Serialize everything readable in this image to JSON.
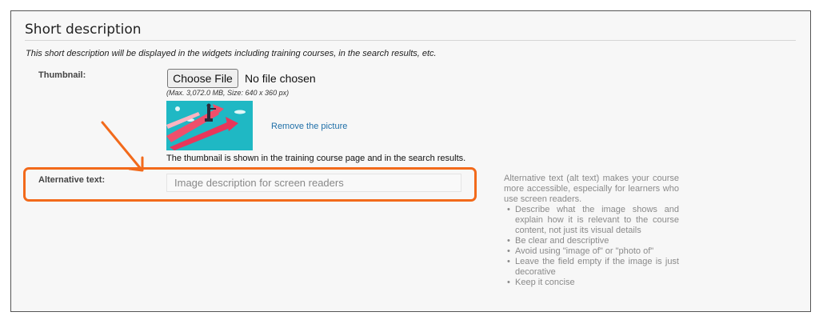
{
  "section": {
    "title": "Short description",
    "description": "This short description will be displayed in the widgets including training courses, in the search results, etc."
  },
  "thumbnail": {
    "label": "Thumbnail:",
    "choose_button": "Choose File",
    "no_file": "No file chosen",
    "hint": "(Max. 3,072.0 MB, Size: 640 x 360 px)",
    "remove_link": "Remove the picture",
    "note": "The thumbnail is shown in the training course page and in the search results."
  },
  "alt_text": {
    "label": "Alternative text:",
    "placeholder": "Image description for screen readers",
    "value": "",
    "help_intro": "Alternative text (alt text) makes your course more accessible, especially for learners who use screen readers.",
    "help_items": [
      "Describe what the image shows and explain how it is relevant to the course content, not just its visual details",
      "Be clear and descriptive",
      "Avoid using \"image of\" or \"photo of\"",
      "Leave the field empty if the image is just decorative",
      "Keep it concise"
    ]
  },
  "colors": {
    "highlight": "#f26a1b",
    "link": "#1f6fa8",
    "thumbnail_bg": "#1fb8c4"
  },
  "icons": {
    "arrow": "orange-annotation-arrow",
    "thumbnail": "growth-arrows-illustration"
  }
}
